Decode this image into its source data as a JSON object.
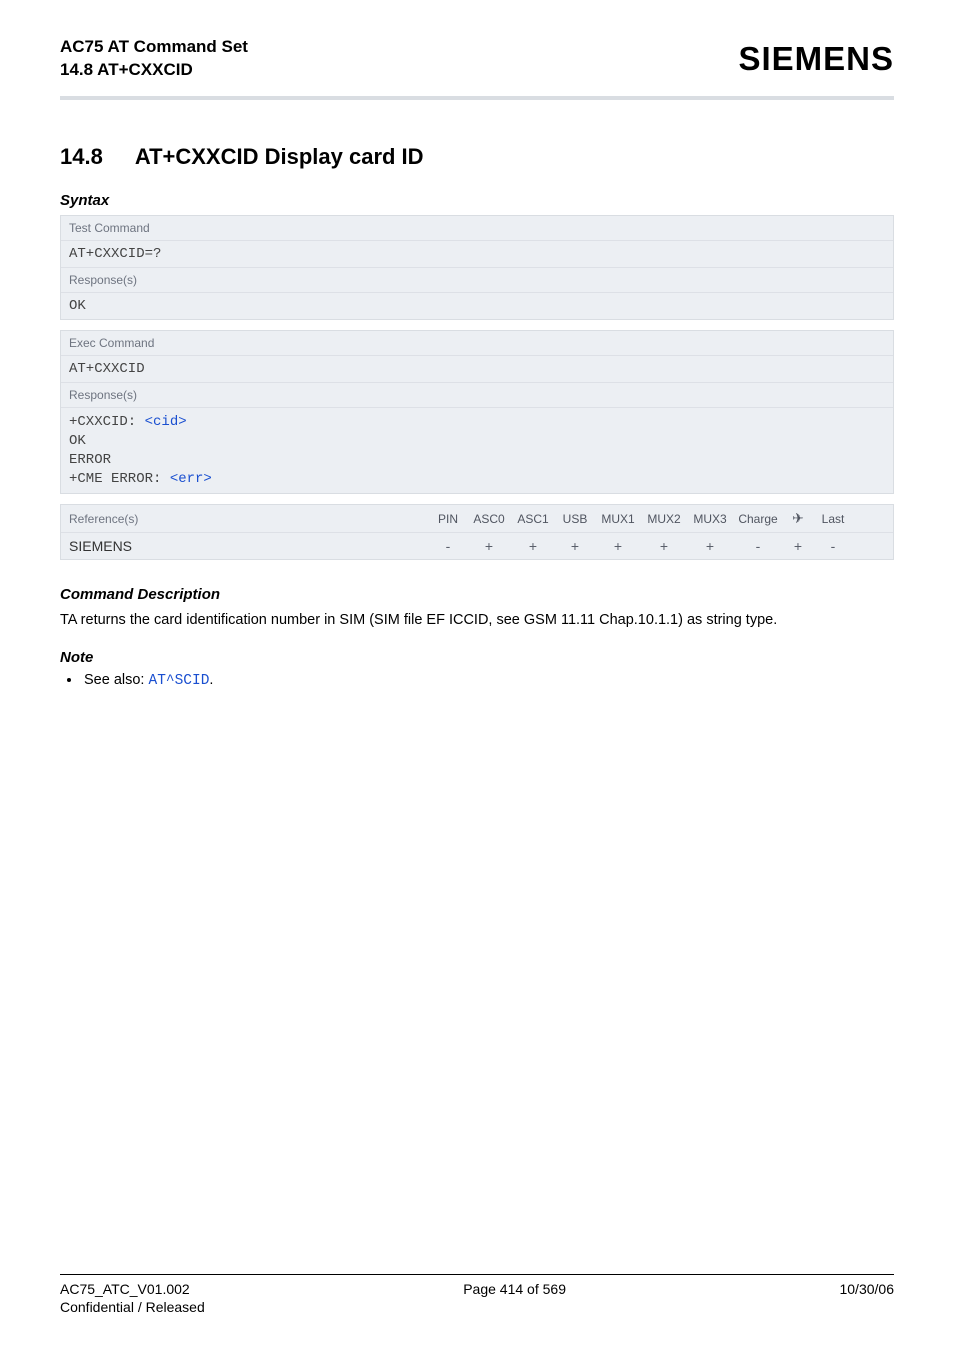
{
  "header": {
    "line1": "AC75 AT Command Set",
    "line2": "14.8 AT+CXXCID",
    "brand": "SIEMENS"
  },
  "section": {
    "number": "14.8",
    "title": "AT+CXXCID   Display card ID"
  },
  "labels": {
    "syntax": "Syntax",
    "test_command": "Test Command",
    "exec_command": "Exec Command",
    "responses": "Response(s)",
    "references": "Reference(s)",
    "command_description": "Command Description",
    "note": "Note"
  },
  "test_block": {
    "cmd": "AT+CXXCID=?",
    "resp1": "OK"
  },
  "exec_block": {
    "cmd": "AT+CXXCID",
    "resp_line1_prefix": "+CXXCID: ",
    "resp_line1_param": "<cid>",
    "resp_line2": "OK",
    "resp_line3": "ERROR",
    "resp_line4_prefix": "+CME ERROR: ",
    "resp_line4_param": "<err>"
  },
  "ref_table": {
    "headers": {
      "pin": "PIN",
      "asc0": "ASC0",
      "asc1": "ASC1",
      "usb": "USB",
      "mux1": "MUX1",
      "mux2": "MUX2",
      "mux3": "MUX3",
      "charge": "Charge",
      "air": "✈",
      "last": "Last"
    },
    "row": {
      "name": "SIEMENS",
      "pin": "-",
      "asc0": "+",
      "asc1": "+",
      "usb": "+",
      "mux1": "+",
      "mux2": "+",
      "mux3": "+",
      "charge": "-",
      "air": "+",
      "last": "-"
    }
  },
  "description": "TA returns the card identification number in SIM (SIM file EF ICCID, see GSM 11.11 Chap.10.1.1) as string type.",
  "note_item": {
    "prefix": "See also: ",
    "link": "AT^SCID",
    "suffix": "."
  },
  "footer": {
    "left": "AC75_ATC_V01.002",
    "center": "Page 414 of 569",
    "right": "10/30/06",
    "left2": "Confidential / Released"
  }
}
